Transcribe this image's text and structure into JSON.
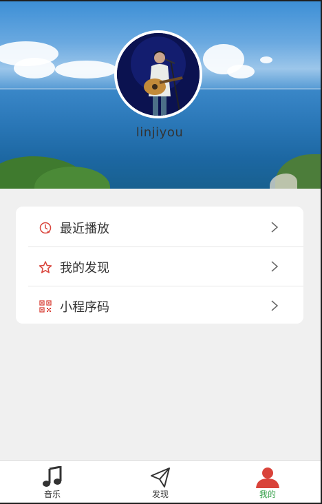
{
  "profile": {
    "username": "linjiyou"
  },
  "menu": {
    "items": [
      {
        "label": "最近播放",
        "icon": "recent-play-icon"
      },
      {
        "label": "我的发现",
        "icon": "star-icon"
      },
      {
        "label": "小程序码",
        "icon": "qr-code-icon"
      }
    ]
  },
  "tabbar": {
    "tabs": [
      {
        "label": "音乐",
        "icon": "music-note-icon",
        "active": false
      },
      {
        "label": "发现",
        "icon": "paper-plane-icon",
        "active": false
      },
      {
        "label": "我的",
        "icon": "user-icon",
        "active": true
      }
    ]
  },
  "colors": {
    "accent_red": "#d9433a",
    "active_tab_text": "#36a04a",
    "page_bg": "#f0f0f0"
  }
}
